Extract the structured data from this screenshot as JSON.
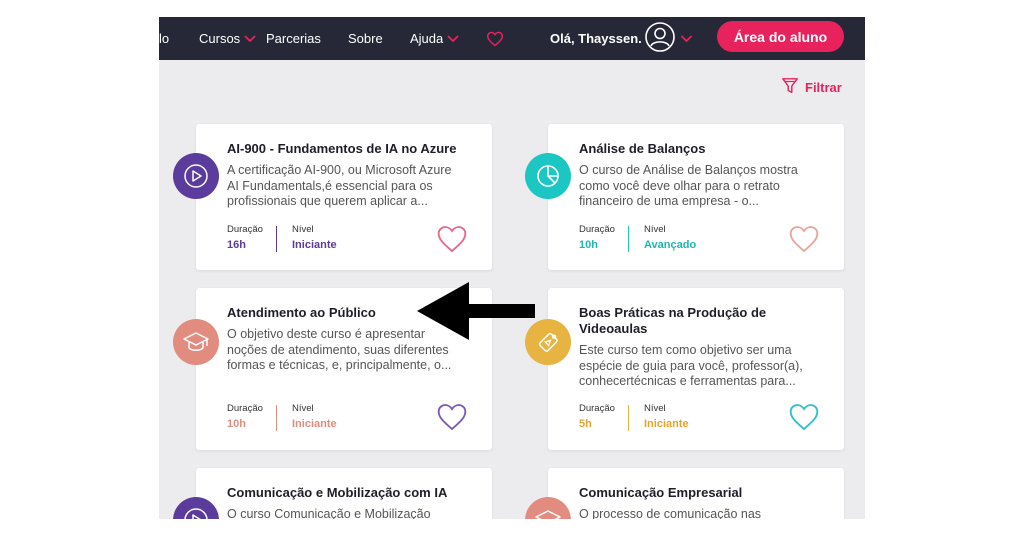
{
  "nav": {
    "partial_item": "lo",
    "courses": "Cursos",
    "partnerships": "Parcerias",
    "about": "Sobre",
    "help": "Ajuda",
    "greeting": "Olá, Thayssen.",
    "student_area": "Área do aluno"
  },
  "filter": {
    "label": "Filtrar"
  },
  "labels": {
    "duration": "Duração",
    "level": "Nível"
  },
  "courses": [
    {
      "title": "AI-900 - Fundamentos de IA no Azure",
      "desc": [
        "A certificação AI-900, ou Microsoft Azure",
        "AI Fundamentals,é essencial para os",
        "profissionais que querem aplicar a..."
      ],
      "duration": "16h",
      "level": "Iniciante",
      "icon": "play-icon",
      "accent": "#5b3b9c",
      "heart_color": "#e8678a"
    },
    {
      "title": "Análise de Balanços",
      "desc": [
        "O curso de Análise de Balanços mostra",
        "como você deve olhar para o retrato",
        "financeiro de uma empresa - o..."
      ],
      "duration": "10h",
      "level": "Avançado",
      "icon": "pie-chart-icon",
      "accent": "#1cc6c3",
      "heart_color": "#e8a59a"
    },
    {
      "title": "Atendimento ao Público",
      "desc": [
        "O objetivo deste curso é apresentar",
        "noções de atendimento, suas diferentes",
        "formas e técnicas, e, principalmente, o..."
      ],
      "duration": "10h",
      "level": "Iniciante",
      "icon": "graduation-cap-icon",
      "accent": "#e28c7f",
      "heart_color": "#7a5ab5"
    },
    {
      "title_lines": [
        "Boas Práticas na Produção de",
        "Videoaulas"
      ],
      "desc": [
        "Este curso tem como objetivo ser uma",
        "espécie de guia para você, professor(a),",
        "conhecertécnicas e ferramentas para..."
      ],
      "duration": "5h",
      "level": "Iniciante",
      "icon": "video-tag-icon",
      "accent": "#e8b441",
      "heart_color": "#2bbfd0"
    },
    {
      "title": "Comunicação e Mobilização com IA",
      "desc": [
        "O curso Comunicação e Mobilização"
      ],
      "icon": "play-icon",
      "accent": "#5b3b9c"
    },
    {
      "title": "Comunicação Empresarial",
      "desc": [
        "O processo de comunicação nas"
      ],
      "icon": "graduation-cap-icon",
      "accent": "#e28c7f"
    }
  ],
  "colors": {
    "brand": "#e8225c",
    "navbar": "#262838",
    "background": "#ececee"
  }
}
